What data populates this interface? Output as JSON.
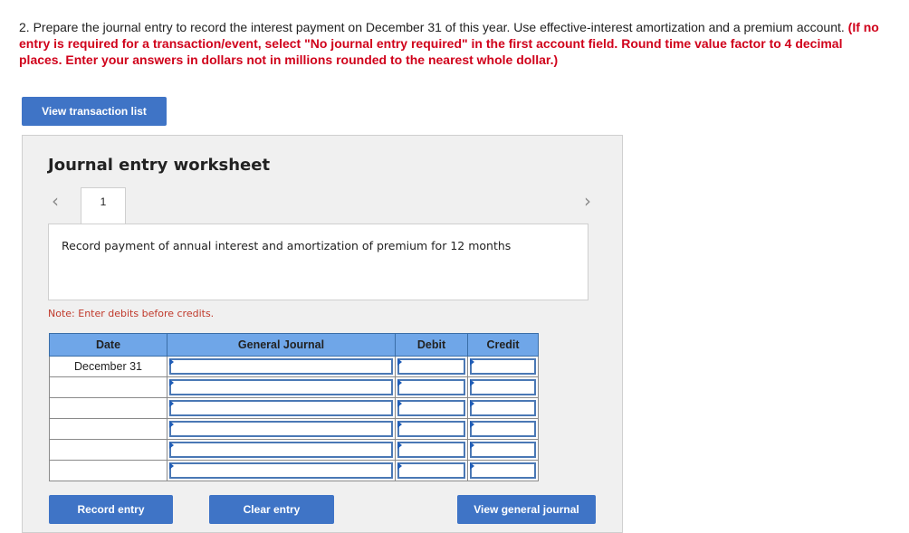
{
  "question": {
    "text": "2. Prepare the journal entry to record the interest payment on December 31 of this year. Use effective-interest amortization and a premium account. ",
    "instructions": "(If no entry is required for a transaction/event, select \"No journal entry required\" in the first account field. Round time value factor to 4 decimal places. Enter your answers in dollars not in millions rounded to the nearest whole dollar.)"
  },
  "buttons": {
    "view_transaction_list": "View transaction list",
    "record_entry": "Record entry",
    "clear_entry": "Clear entry",
    "view_general_journal": "View general journal"
  },
  "worksheet": {
    "title": "Journal entry worksheet",
    "prev_icon": "‹",
    "next_icon": "›",
    "active_tab": "1",
    "description": "Record payment of annual interest and amortization of premium for 12 months",
    "note": "Note: Enter debits before credits."
  },
  "table": {
    "headers": [
      "Date",
      "General Journal",
      "Debit",
      "Credit"
    ],
    "rows": [
      {
        "date": "December 31",
        "account": "",
        "debit": "",
        "credit": ""
      },
      {
        "date": "",
        "account": "",
        "debit": "",
        "credit": ""
      },
      {
        "date": "",
        "account": "",
        "debit": "",
        "credit": ""
      },
      {
        "date": "",
        "account": "",
        "debit": "",
        "credit": ""
      },
      {
        "date": "",
        "account": "",
        "debit": "",
        "credit": ""
      },
      {
        "date": "",
        "account": "",
        "debit": "",
        "credit": ""
      }
    ]
  },
  "colors": {
    "accent": "#3f74c6",
    "header_bg": "#6fa6e8",
    "warning": "#d0021b"
  }
}
